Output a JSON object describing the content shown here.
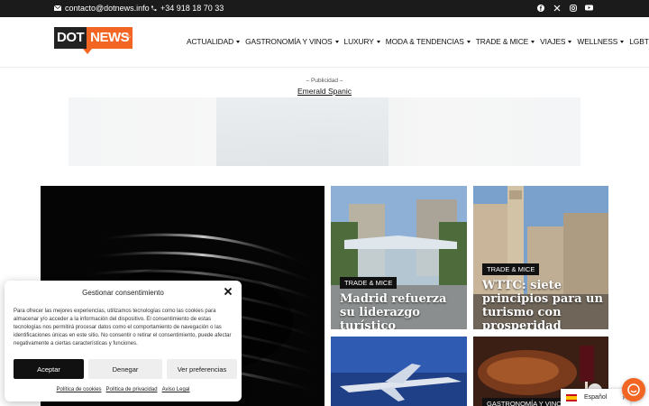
{
  "topbar": {
    "email": "contacto@dotnews.info",
    "phone": "+34 918 18 70 33",
    "socials": [
      "facebook-icon",
      "x-icon",
      "instagram-icon",
      "youtube-icon"
    ]
  },
  "header": {
    "logo_dot": "DOT",
    "logo_news": "NEWS",
    "logo_info": "INFO",
    "nav": [
      "ACTUALIDAD",
      "GASTRONOMÍA Y VINOS",
      "LUXURY",
      "MODA & TENDENCIAS",
      "TRADE & MICE",
      "VIAJES",
      "WELLNESS",
      "LGBT"
    ]
  },
  "ad": {
    "label": "– Publicidad –",
    "link": "Emerald Spanic"
  },
  "cards": [
    {
      "tag": "TRADE & MICE",
      "title": "Madrid refuerza su liderazgo turístico"
    },
    {
      "tag": "TRADE & MICE",
      "title": "WTTC: siete principios para un turismo con prosperidad compartida"
    },
    {
      "tag": "",
      "title": ""
    },
    {
      "tag": "GASTRONOMÍA Y VINOS",
      "title": ""
    }
  ],
  "consent": {
    "title": "Gestionar consentimiento",
    "text": "Para ofrecer las mejores experiencias, utilizamos tecnologías como las cookies para almacenar y/o acceder a la información del dispositivo. El consentimiento de estas tecnologías nos permitirá procesar datos como el comportamiento de navegación o las identificaciones únicas en este sitio. No consentir o retirar el consentimiento, puede afectar negativamente a ciertas características y funciones.",
    "accept": "Aceptar",
    "deny": "Denegar",
    "prefs": "Ver preferencias",
    "links": [
      "Política de cookies",
      "Política de privacidad",
      "Aviso Legal"
    ]
  },
  "language": {
    "label": "Español"
  },
  "colors": {
    "accent": "#f26522",
    "dark": "#111111"
  }
}
